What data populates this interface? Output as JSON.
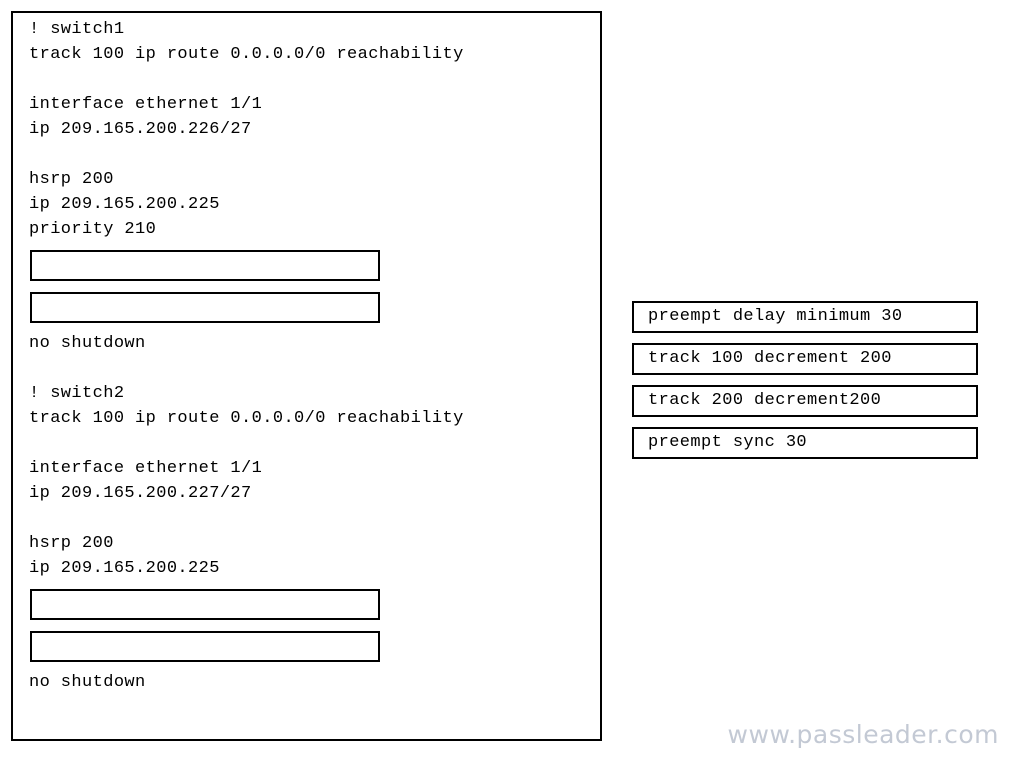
{
  "colors": {
    "background": "#ffffff",
    "border": "#000000",
    "text": "#000000",
    "watermark": "#c3c9d4"
  },
  "config_panel": {
    "blocks": [
      {
        "id": "switch1",
        "lines": [
          "! switch1",
          "track 100 ip route 0.0.0.0/0 reachability",
          "",
          "interface ethernet 1/1",
          "ip 209.165.200.226/27",
          "",
          "hsrp 200",
          "ip 209.165.200.225",
          "priority 210"
        ],
        "drop_slots": [
          {
            "id": "switch1-slot-1",
            "value": ""
          },
          {
            "id": "switch1-slot-2",
            "value": ""
          }
        ],
        "trailing_lines": [
          "no shutdown"
        ]
      },
      {
        "id": "switch2",
        "lines": [
          "",
          "! switch2",
          "track 100 ip route 0.0.0.0/0 reachability",
          "",
          "interface ethernet 1/1",
          "ip 209.165.200.227/27",
          "",
          "hsrp 200",
          "ip 209.165.200.225"
        ],
        "drop_slots": [
          {
            "id": "switch2-slot-1",
            "value": ""
          },
          {
            "id": "switch2-slot-2",
            "value": ""
          }
        ],
        "trailing_lines": [
          "no shutdown"
        ]
      }
    ]
  },
  "options": [
    {
      "id": "option-1",
      "label": "preempt delay minimum 30"
    },
    {
      "id": "option-2",
      "label": "track 100 decrement 200"
    },
    {
      "id": "option-3",
      "label": "track 200 decrement200"
    },
    {
      "id": "option-4",
      "label": "preempt sync 30"
    }
  ],
  "watermark": {
    "text": "www.passleader.com"
  }
}
